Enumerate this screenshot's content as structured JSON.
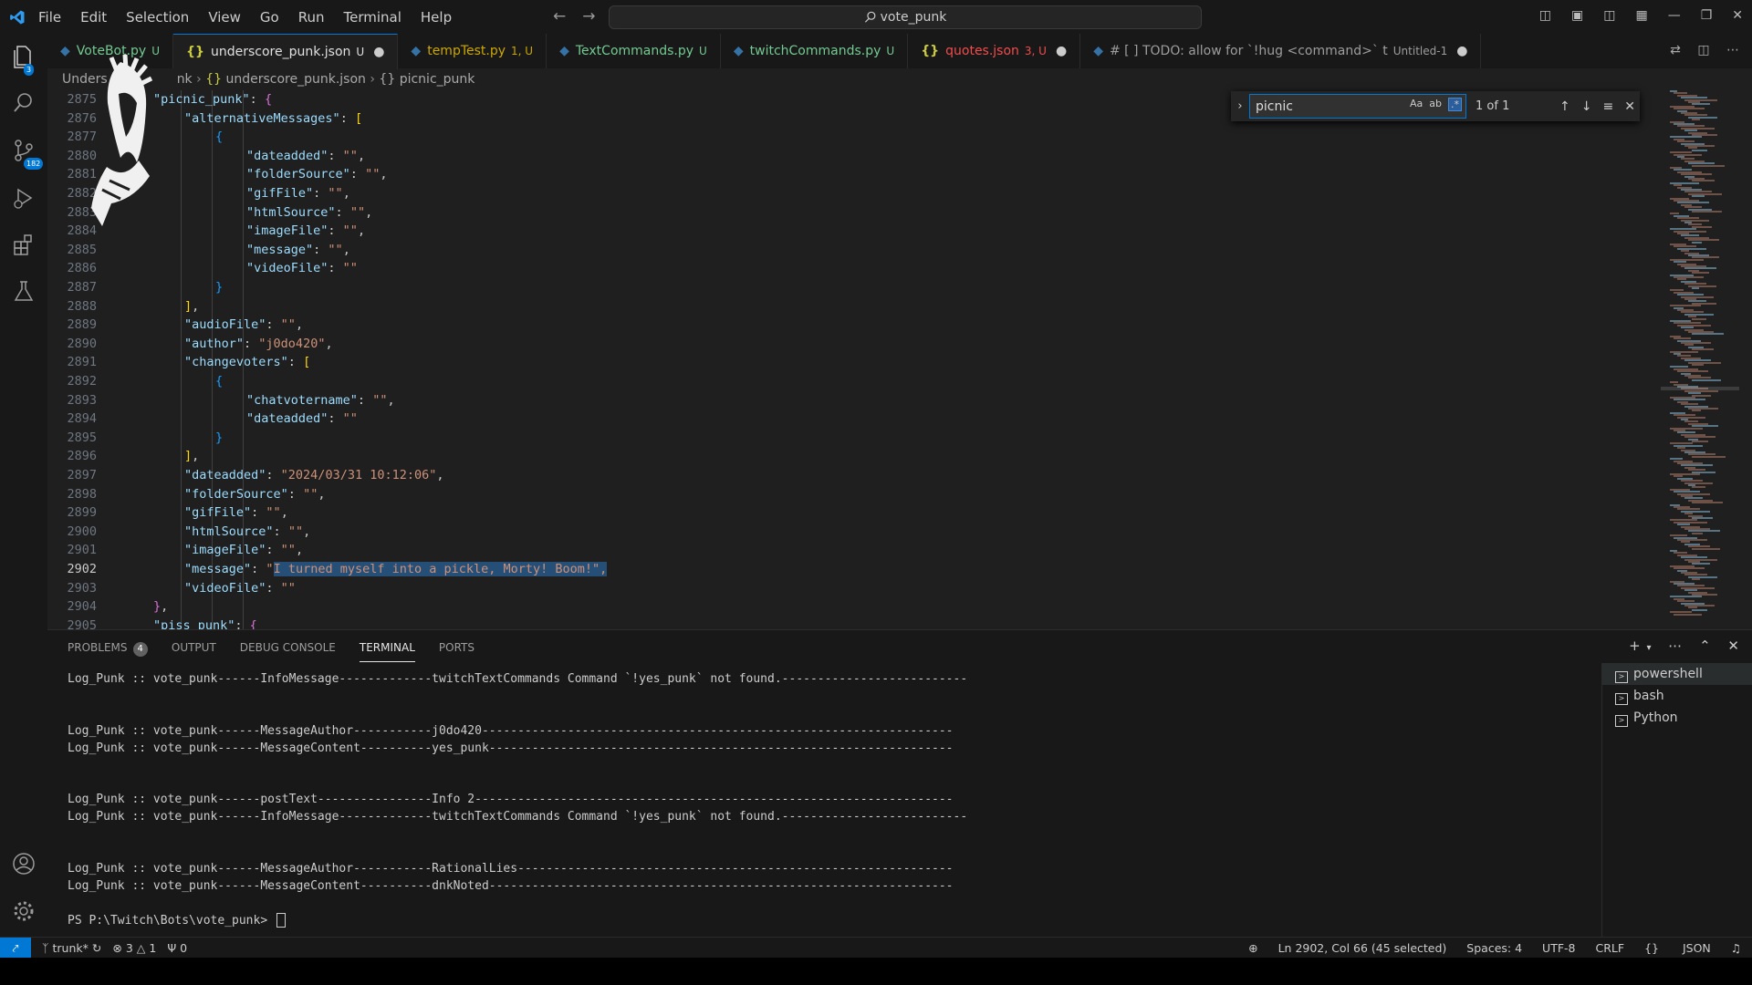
{
  "title_bar": {
    "menu": [
      "File",
      "Edit",
      "Selection",
      "View",
      "Go",
      "Run",
      "Terminal",
      "Help"
    ],
    "search_text": "vote_punk"
  },
  "activity_badges": {
    "explorer": "3",
    "source_control": "182"
  },
  "tabs": [
    {
      "label": "VoteBot.py",
      "status": "U",
      "color": "#73c991",
      "icon": "python-icon",
      "dot": false
    },
    {
      "label": "underscore_punk.json",
      "status": "U",
      "color": "#e0e0e0",
      "icon": "json-icon",
      "dot": true
    },
    {
      "label": "tempTest.py",
      "status": "1, U",
      "color": "#cca700",
      "icon": "python-icon",
      "dot": false
    },
    {
      "label": "TextCommands.py",
      "status": "U",
      "color": "#73c991",
      "icon": "python-icon",
      "dot": false
    },
    {
      "label": "twitchCommands.py",
      "status": "U",
      "color": "#73c991",
      "icon": "python-icon",
      "dot": false
    },
    {
      "label": "quotes.json",
      "status": "3, U",
      "color": "#f14c4c",
      "icon": "json-icon",
      "dot": true
    },
    {
      "label": "# [ ] TODO: allow for `!hug <command>` t",
      "status": "Untitled-1",
      "color": "#9d9d9d",
      "icon": "python-icon",
      "dot": true
    }
  ],
  "breadcrumb": {
    "part1": "Unders",
    "part2": "nk",
    "file": "underscore_punk.json",
    "symbol": "picnic_punk"
  },
  "find": {
    "query": "picnic",
    "case": "Aa",
    "word": "ab",
    "regex": ".*",
    "count": "1 of 1"
  },
  "editor_lines": [
    {
      "n": "2875",
      "i": 1,
      "t": [
        [
          "k",
          "\"picnic_punk\""
        ],
        [
          "p",
          ": "
        ],
        [
          "b1",
          "{"
        ]
      ]
    },
    {
      "n": "2876",
      "i": 2,
      "t": [
        [
          "k",
          "\"alternativeMessages\""
        ],
        [
          "p",
          ": "
        ],
        [
          "b2",
          "["
        ]
      ]
    },
    {
      "n": "2877",
      "i": 3,
      "t": [
        [
          "b3",
          "{"
        ]
      ]
    },
    {
      "n": "2880",
      "i": 4,
      "t": [
        [
          "k",
          "\"dateadded\""
        ],
        [
          "p",
          ": "
        ],
        [
          "s",
          "\"\""
        ],
        [
          "p",
          ","
        ]
      ]
    },
    {
      "n": "2881",
      "i": 4,
      "t": [
        [
          "k",
          "\"folderSource\""
        ],
        [
          "p",
          ": "
        ],
        [
          "s",
          "\"\""
        ],
        [
          "p",
          ","
        ]
      ]
    },
    {
      "n": "2882",
      "i": 4,
      "t": [
        [
          "k",
          "\"gifFile\""
        ],
        [
          "p",
          ": "
        ],
        [
          "s",
          "\"\""
        ],
        [
          "p",
          ","
        ]
      ]
    },
    {
      "n": "2883",
      "i": 4,
      "t": [
        [
          "k",
          "\"htmlSource\""
        ],
        [
          "p",
          ": "
        ],
        [
          "s",
          "\"\""
        ],
        [
          "p",
          ","
        ]
      ]
    },
    {
      "n": "2884",
      "i": 4,
      "t": [
        [
          "k",
          "\"imageFile\""
        ],
        [
          "p",
          ": "
        ],
        [
          "s",
          "\"\""
        ],
        [
          "p",
          ","
        ]
      ]
    },
    {
      "n": "2885",
      "i": 4,
      "t": [
        [
          "k",
          "\"message\""
        ],
        [
          "p",
          ": "
        ],
        [
          "s",
          "\"\""
        ],
        [
          "p",
          ","
        ]
      ]
    },
    {
      "n": "2886",
      "i": 4,
      "t": [
        [
          "k",
          "\"videoFile\""
        ],
        [
          "p",
          ": "
        ],
        [
          "s",
          "\"\""
        ]
      ]
    },
    {
      "n": "2887",
      "i": 3,
      "t": [
        [
          "b3",
          "}"
        ]
      ]
    },
    {
      "n": "2888",
      "i": 2,
      "t": [
        [
          "b2",
          "]"
        ],
        [
          "p",
          ","
        ]
      ]
    },
    {
      "n": "2889",
      "i": 2,
      "t": [
        [
          "k",
          "\"audioFile\""
        ],
        [
          "p",
          ": "
        ],
        [
          "s",
          "\"\""
        ],
        [
          "p",
          ","
        ]
      ]
    },
    {
      "n": "2890",
      "i": 2,
      "t": [
        [
          "k",
          "\"author\""
        ],
        [
          "p",
          ": "
        ],
        [
          "s",
          "\"j0do420\""
        ],
        [
          "p",
          ","
        ]
      ]
    },
    {
      "n": "2891",
      "i": 2,
      "t": [
        [
          "k",
          "\"changevoters\""
        ],
        [
          "p",
          ": "
        ],
        [
          "b2",
          "["
        ]
      ]
    },
    {
      "n": "2892",
      "i": 3,
      "t": [
        [
          "b3",
          "{"
        ]
      ]
    },
    {
      "n": "2893",
      "i": 4,
      "t": [
        [
          "k",
          "\"chatvotername\""
        ],
        [
          "p",
          ": "
        ],
        [
          "s",
          "\"\""
        ],
        [
          "p",
          ","
        ]
      ]
    },
    {
      "n": "2894",
      "i": 4,
      "t": [
        [
          "k",
          "\"dateadded\""
        ],
        [
          "p",
          ": "
        ],
        [
          "s",
          "\"\""
        ]
      ]
    },
    {
      "n": "2895",
      "i": 3,
      "t": [
        [
          "b3",
          "}"
        ]
      ]
    },
    {
      "n": "2896",
      "i": 2,
      "t": [
        [
          "b2",
          "]"
        ],
        [
          "p",
          ","
        ]
      ]
    },
    {
      "n": "2897",
      "i": 2,
      "t": [
        [
          "k",
          "\"dateadded\""
        ],
        [
          "p",
          ": "
        ],
        [
          "s",
          "\"2024/03/31 10:12:06\""
        ],
        [
          "p",
          ","
        ]
      ]
    },
    {
      "n": "2898",
      "i": 2,
      "t": [
        [
          "k",
          "\"folderSource\""
        ],
        [
          "p",
          ": "
        ],
        [
          "s",
          "\"\""
        ],
        [
          "p",
          ","
        ]
      ]
    },
    {
      "n": "2899",
      "i": 2,
      "t": [
        [
          "k",
          "\"gifFile\""
        ],
        [
          "p",
          ": "
        ],
        [
          "s",
          "\"\""
        ],
        [
          "p",
          ","
        ]
      ]
    },
    {
      "n": "2900",
      "i": 2,
      "t": [
        [
          "k",
          "\"htmlSource\""
        ],
        [
          "p",
          ": "
        ],
        [
          "s",
          "\"\""
        ],
        [
          "p",
          ","
        ]
      ]
    },
    {
      "n": "2901",
      "i": 2,
      "t": [
        [
          "k",
          "\"imageFile\""
        ],
        [
          "p",
          ": "
        ],
        [
          "s",
          "\"\""
        ],
        [
          "p",
          ","
        ]
      ]
    },
    {
      "n": "2902",
      "i": 2,
      "cur": true,
      "t": [
        [
          "k",
          "\"message\""
        ],
        [
          "p",
          ": "
        ],
        [
          "s",
          "\""
        ],
        [
          "sel",
          "I turned myself into a pickle, Morty! Boom!\","
        ]
      ]
    },
    {
      "n": "2903",
      "i": 2,
      "t": [
        [
          "k",
          "\"videoFile\""
        ],
        [
          "p",
          ": "
        ],
        [
          "s",
          "\"\""
        ]
      ]
    },
    {
      "n": "2904",
      "i": 1,
      "t": [
        [
          "b1",
          "}"
        ],
        [
          "p",
          ","
        ]
      ]
    },
    {
      "n": "2905",
      "i": 1,
      "t": [
        [
          "k",
          "\"piss_punk\""
        ],
        [
          "p",
          ": "
        ],
        [
          "b1",
          "{"
        ]
      ]
    }
  ],
  "panel": {
    "tabs": [
      "PROBLEMS",
      "OUTPUT",
      "DEBUG CONSOLE",
      "TERMINAL",
      "PORTS"
    ],
    "problems_count": "4",
    "terminal_lines": [
      "Log_Punk :: vote_punk------InfoMessage-------------twitchTextCommands Command `!yes_punk` not found.--------------------------",
      "",
      "",
      "Log_Punk :: vote_punk------MessageAuthor-----------j0do420------------------------------------------------------------------",
      "Log_Punk :: vote_punk------MessageContent----------yes_punk-----------------------------------------------------------------",
      "",
      "",
      "Log_Punk :: vote_punk------postText----------------Info 2-------------------------------------------------------------------",
      "Log_Punk :: vote_punk------InfoMessage-------------twitchTextCommands Command `!yes_punk` not found.--------------------------",
      "",
      "",
      "Log_Punk :: vote_punk------MessageAuthor-----------RationalLies-------------------------------------------------------------",
      "Log_Punk :: vote_punk------MessageContent----------dnkNoted-----------------------------------------------------------------",
      "",
      "PS P:\\Twitch\\Bots\\vote_punk> "
    ],
    "shells": [
      "powershell",
      "bash",
      "Python"
    ]
  },
  "status_bar": {
    "branch": "trunk*",
    "errors": "3",
    "warnings": "1",
    "ports": "0",
    "position": "Ln 2902, Col 66 (45 selected)",
    "spaces": "Spaces: 4",
    "encoding": "UTF-8",
    "eol": "CRLF",
    "language": "JSON"
  }
}
